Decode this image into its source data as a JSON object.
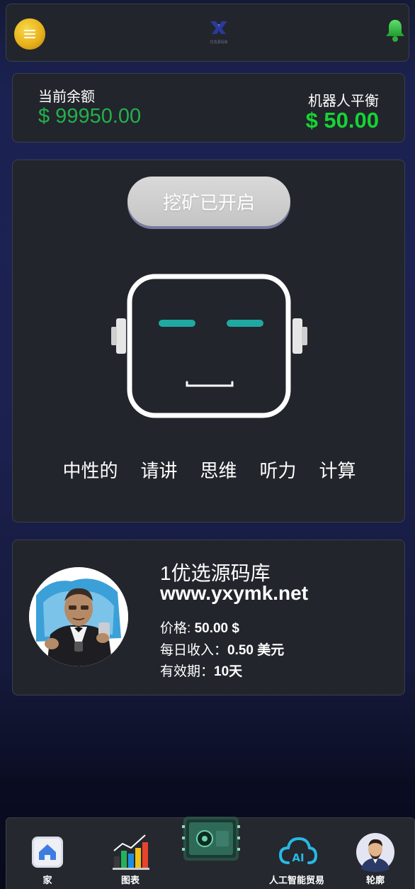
{
  "header": {
    "logo_text": "优选源码库"
  },
  "balance": {
    "current_label": "当前余额",
    "current_value": "$ 99950.00",
    "robot_label": "机器人平衡",
    "robot_value": "$ 50.00"
  },
  "mining": {
    "button_label": "挖矿已开启",
    "modes": [
      "中性的",
      "请讲",
      "思维",
      "听力",
      "计算"
    ]
  },
  "product": {
    "title": "1优选源码库",
    "url": "www.yxymk.net",
    "price_label": "价格: ",
    "price_value": "50.00 $",
    "daily_label": "每日收入：",
    "daily_value": "0.50 美元",
    "validity_label": "有效期：",
    "validity_value": "10天"
  },
  "nav": {
    "items": [
      {
        "label": "家",
        "icon": "home-icon"
      },
      {
        "label": "图表",
        "icon": "chart-icon"
      },
      {
        "label": "",
        "icon": "chip-icon"
      },
      {
        "label": "人工智能贸易",
        "icon": "ai-cloud-icon"
      },
      {
        "label": "轮廓",
        "icon": "profile-icon"
      }
    ]
  },
  "colors": {
    "accent_green": "#22b14c",
    "robot_green": "#16d433",
    "eye_teal": "#1fa9a0",
    "menu_gold": "#e8b21c"
  }
}
